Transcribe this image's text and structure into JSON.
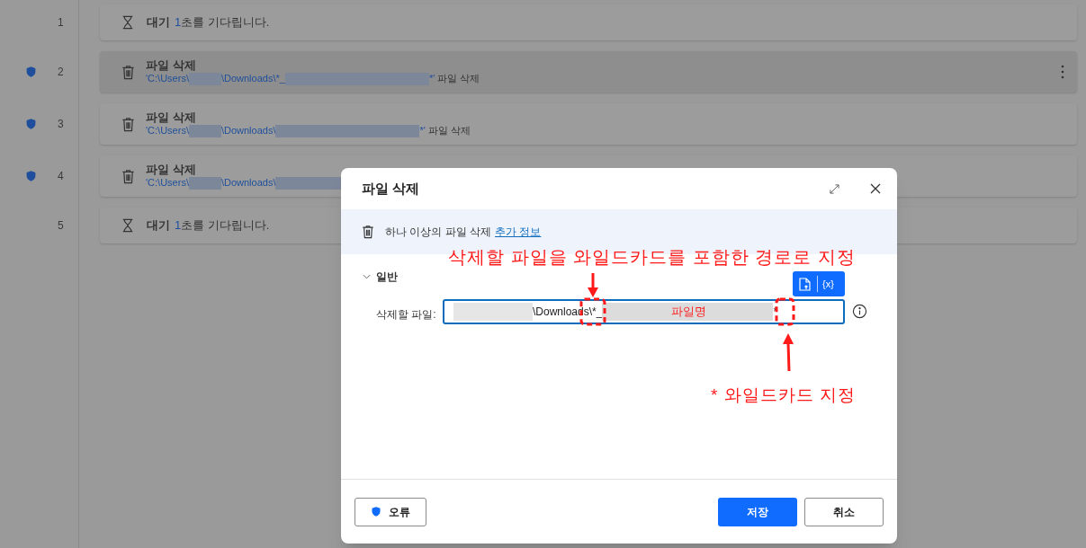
{
  "steps": [
    {
      "number": "1",
      "kind": "wait",
      "shield": false,
      "selected": false,
      "title": "대기",
      "value": "1",
      "rest": "초를 기다립니다."
    },
    {
      "number": "2",
      "kind": "delete",
      "shield": true,
      "selected": true,
      "title": "파일 삭제",
      "path": [
        {
          "kind": "text",
          "text": "'C:\\Users\\"
        },
        {
          "kind": "redacted"
        },
        {
          "kind": "text",
          "text": "\\Downloads\\*_"
        },
        {
          "kind": "redacted"
        },
        {
          "kind": "text",
          "text": "*'"
        }
      ],
      "suffix": "파일 삭제"
    },
    {
      "number": "3",
      "kind": "delete",
      "shield": true,
      "selected": false,
      "title": "파일 삭제",
      "path": [
        {
          "kind": "text",
          "text": "'C:\\Users\\"
        },
        {
          "kind": "redacted"
        },
        {
          "kind": "text",
          "text": "\\Downloads\\"
        },
        {
          "kind": "redacted"
        },
        {
          "kind": "text",
          "text": "*'"
        }
      ],
      "suffix": "파일 삭제"
    },
    {
      "number": "4",
      "kind": "delete",
      "shield": true,
      "selected": false,
      "title": "파일 삭제",
      "path": [
        {
          "kind": "text",
          "text": "'C:\\Users\\"
        },
        {
          "kind": "redacted"
        },
        {
          "kind": "text",
          "text": "\\Downloads\\"
        },
        {
          "kind": "redacted"
        }
      ]
    },
    {
      "number": "5",
      "kind": "wait",
      "shield": false,
      "selected": false,
      "title": "대기",
      "value": "1",
      "rest": "초를 기다립니다."
    }
  ],
  "dialog": {
    "title": "파일 삭제",
    "description": "하나 이상의 파일 삭제",
    "info_link": "추가 정보",
    "section": {
      "label": "일반",
      "expanded": true
    },
    "field": {
      "label": "삭제할 파일:",
      "value": [
        {
          "kind": "redacted"
        },
        {
          "kind": "text",
          "text": "\\Downloads\\*_"
        },
        {
          "kind": "redacted"
        },
        {
          "kind": "text",
          "text": "*"
        }
      ]
    },
    "variables_button": "{x}",
    "error_button": "오류",
    "save_button": "저장",
    "cancel_button": "취소"
  },
  "annotations": {
    "heading": "삭제할 파일을 와일드카드를 포함한 경로로 지정",
    "filename_label": "파일명",
    "wildcard_note": "* 와일드카드 지정"
  }
}
